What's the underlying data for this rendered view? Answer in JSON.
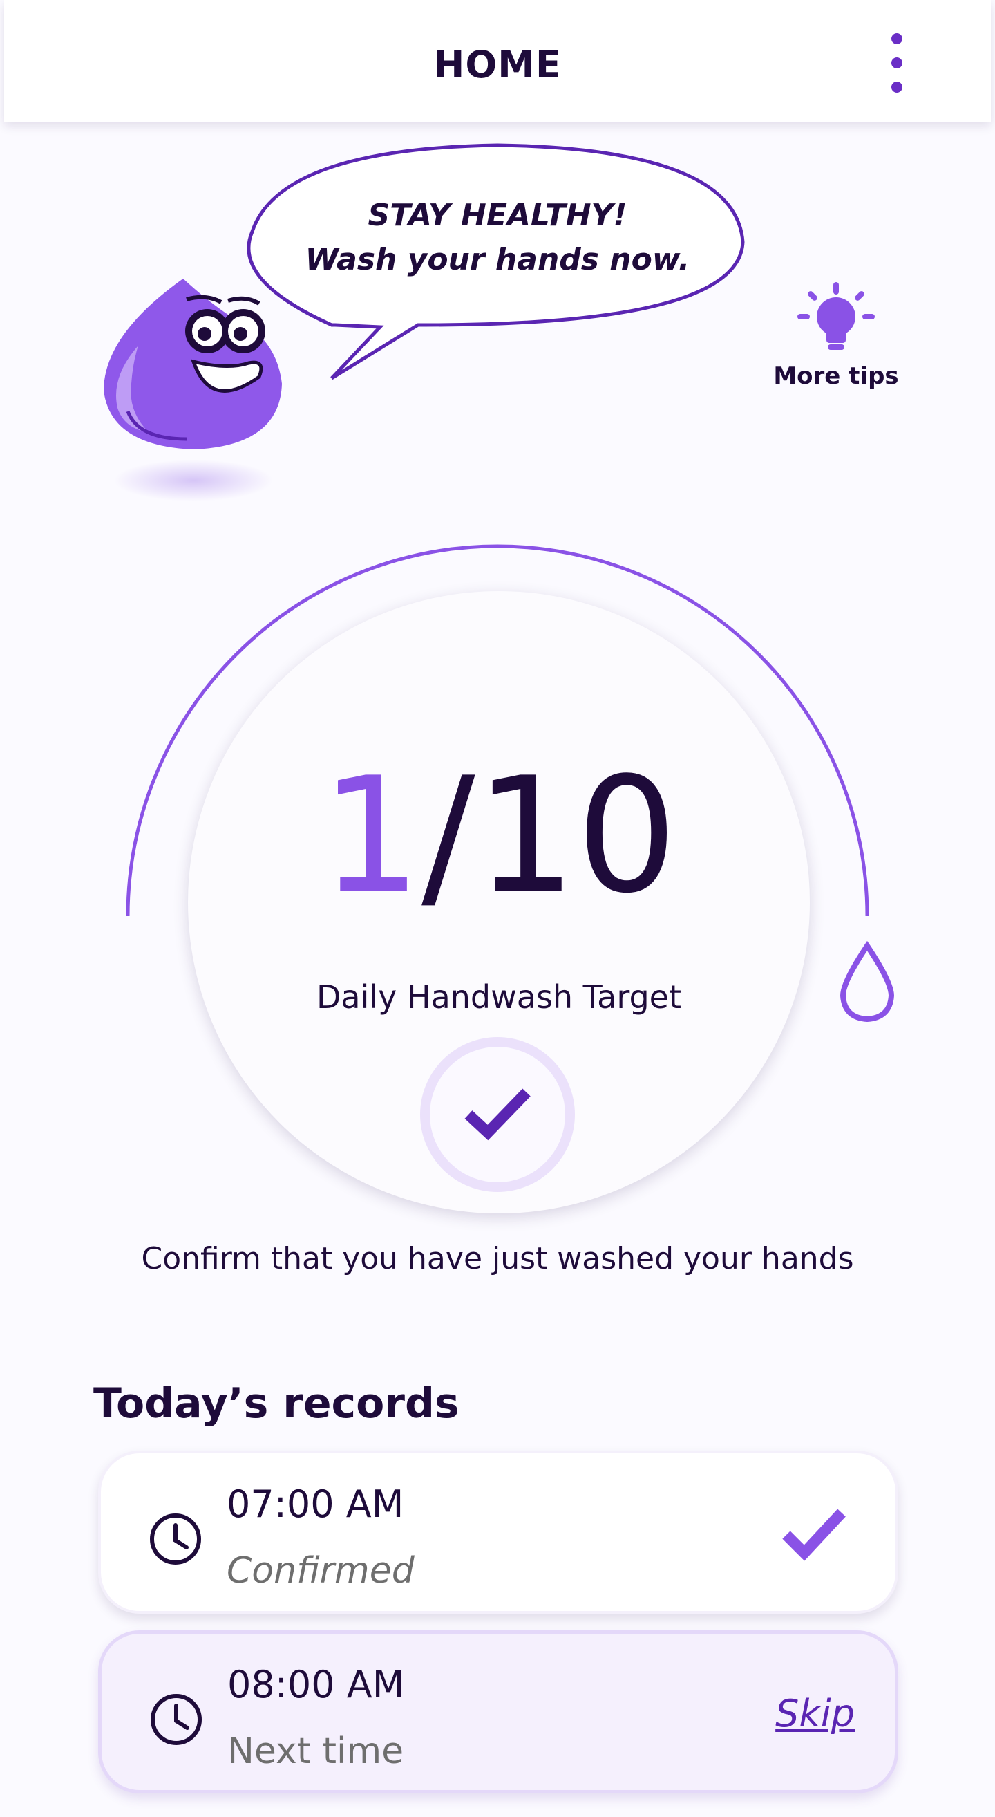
{
  "header": {
    "title": "HOME",
    "menu_icon": "more-vertical-icon"
  },
  "bubble": {
    "line1": "STAY HEALTHY!",
    "line2": "Wash your hands now."
  },
  "tips": {
    "label": "More tips",
    "icon": "lightbulb-icon"
  },
  "progress": {
    "current": "1",
    "separator_total": "/10",
    "label": "Daily Handwash Target",
    "fraction": 0.1
  },
  "confirm": {
    "text": "Confirm that you have just washed your hands",
    "icon": "check-icon"
  },
  "records": {
    "title": "Today’s records",
    "items": [
      {
        "time": "07:00 AM",
        "status": "Confirmed",
        "action": "check-icon"
      },
      {
        "time": "08:00 AM",
        "status": "Next time",
        "action_label": "Skip"
      }
    ]
  },
  "colors": {
    "accent": "#8a52e6",
    "accent_dark": "#5a25b2",
    "text": "#1e0b3a",
    "background": "#fbfaff"
  }
}
